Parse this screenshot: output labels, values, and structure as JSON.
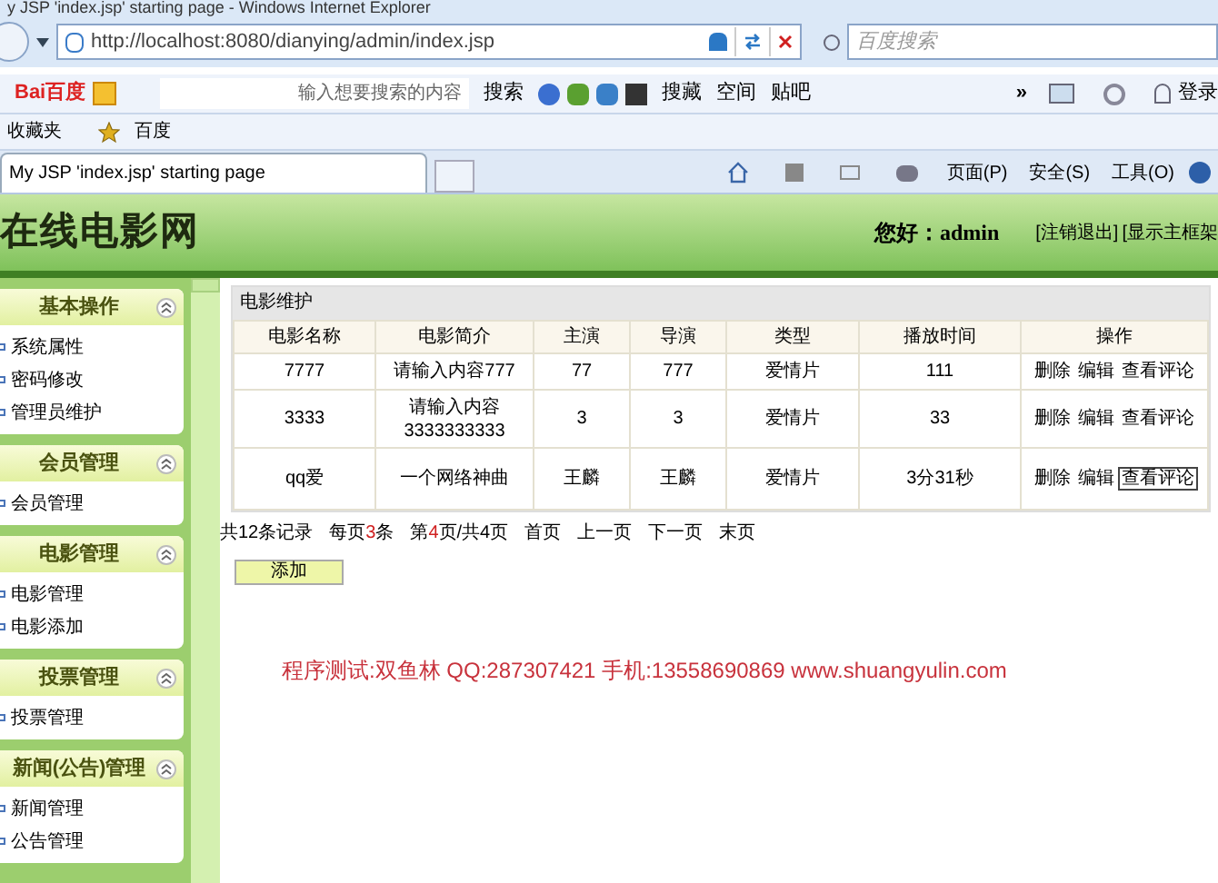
{
  "window": {
    "title": "y JSP 'index.jsp' starting page - Windows Internet Explorer"
  },
  "address_bar": {
    "url": "http://localhost:8080/dianying/admin/index.jsp",
    "search_placeholder": "百度搜索"
  },
  "baidu_toolbar": {
    "logo": "Bai百度",
    "search_placeholder": "输入想要搜索的内容",
    "search_button": "搜索",
    "items": [
      "搜藏",
      "空间",
      "贴吧"
    ],
    "more": "»",
    "login": "登录"
  },
  "favorites_bar": {
    "label": "收藏夹",
    "links": [
      "百度"
    ]
  },
  "tabs": [
    {
      "label": "My JSP 'index.jsp' starting page",
      "selected": true
    }
  ],
  "command_bar": [
    "页面(P)",
    "安全(S)",
    "工具(O)"
  ],
  "header": {
    "site_title": "在线电影网",
    "greeting": "您好：admin",
    "links": [
      "[注销退出]",
      "[显示主框架"
    ]
  },
  "sidebar": [
    {
      "title": "基本操作",
      "expanded": true,
      "items": [
        "系统属性",
        "密码修改",
        "管理员维护"
      ]
    },
    {
      "title": "会员管理",
      "expanded": true,
      "items": [
        "会员管理"
      ]
    },
    {
      "title": "电影管理",
      "expanded": true,
      "items": [
        "电影管理",
        "电影添加"
      ]
    },
    {
      "title": "投票管理",
      "expanded": true,
      "items": [
        "投票管理"
      ]
    },
    {
      "title": "新闻(公告)管理",
      "expanded": true,
      "items": [
        "新闻管理",
        "公告管理"
      ]
    }
  ],
  "table": {
    "title": "电影维护",
    "columns": [
      "电影名称",
      "电影简介",
      "主演",
      "导演",
      "类型",
      "播放时间",
      "操作"
    ],
    "rows": [
      {
        "cells": [
          "7777",
          "请输入内容777",
          "77",
          "777",
          "爱情片",
          "111"
        ],
        "actions": [
          {
            "label": "删除",
            "focused": false
          },
          {
            "label": "编辑",
            "focused": false
          },
          {
            "label": "查看评论",
            "focused": false
          }
        ]
      },
      {
        "cells": [
          "3333",
          "请输入内容3333333333",
          "3",
          "3",
          "爱情片",
          "33"
        ],
        "actions": [
          {
            "label": "删除",
            "focused": false
          },
          {
            "label": "编辑",
            "focused": false
          },
          {
            "label": "查看评论",
            "focused": false
          }
        ]
      },
      {
        "cells": [
          "qq爱",
          "一个网络神曲",
          "王麟",
          "王麟",
          "爱情片",
          "3分31秒"
        ],
        "actions": [
          {
            "label": "删除",
            "focused": false
          },
          {
            "label": "编辑",
            "focused": false
          },
          {
            "label": "查看评论",
            "focused": true
          }
        ]
      }
    ]
  },
  "pager": [
    [
      {
        "text": "共12条记录",
        "highlighted": false
      }
    ],
    [
      {
        "text": "每页",
        "highlighted": false
      },
      {
        "text": "3",
        "highlighted": true
      },
      {
        "text": "条",
        "highlighted": false
      }
    ],
    [
      {
        "text": "第",
        "highlighted": false
      },
      {
        "text": "4",
        "highlighted": true
      },
      {
        "text": "页/共4页",
        "highlighted": false
      }
    ],
    [
      {
        "text": "首页",
        "highlighted": false
      }
    ],
    [
      {
        "text": "上一页",
        "highlighted": false
      }
    ],
    [
      {
        "text": "下一页",
        "highlighted": false
      }
    ],
    [
      {
        "text": "末页",
        "highlighted": false
      }
    ]
  ],
  "add_button": "添加",
  "footer_note": "程序测试:双鱼林 QQ:287307421 手机:13558690869 www.shuangyulin.com"
}
